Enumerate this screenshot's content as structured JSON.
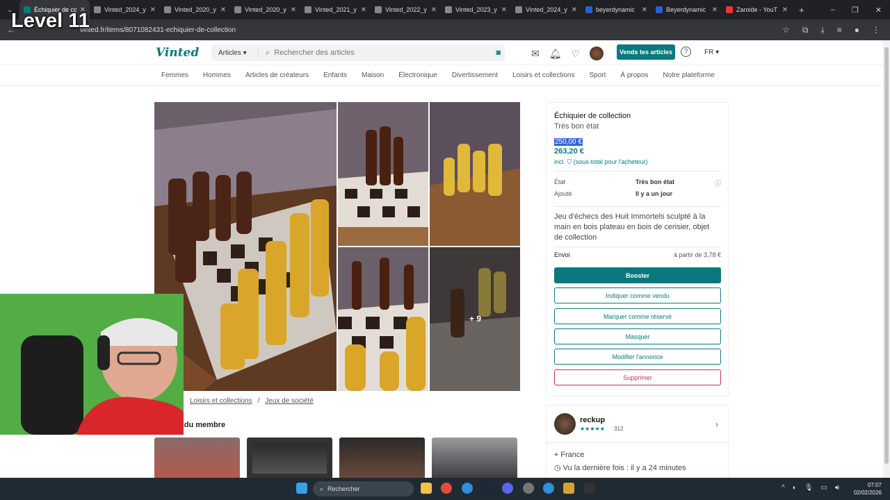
{
  "overlay": {
    "level_text": "Level 11"
  },
  "browser": {
    "tabs": [
      {
        "label": "Échiquier de co",
        "active": true,
        "fav": "#09797e"
      },
      {
        "label": "Vinted_2024_y",
        "active": false,
        "fav": "#888"
      },
      {
        "label": "Vinted_2020_y",
        "active": false,
        "fav": "#888"
      },
      {
        "label": "Vinted_2020_y",
        "active": false,
        "fav": "#888"
      },
      {
        "label": "Vinted_2021_y",
        "active": false,
        "fav": "#888"
      },
      {
        "label": "Vinted_2022_y",
        "active": false,
        "fav": "#888"
      },
      {
        "label": "Vinted_2023_y",
        "active": false,
        "fav": "#888"
      },
      {
        "label": "Vinted_2024_y",
        "active": false,
        "fav": "#888"
      },
      {
        "label": "beyerdynamic",
        "active": false,
        "fav": "#2a62c9"
      },
      {
        "label": "Beyerdynamic",
        "active": false,
        "fav": "#2a62c9"
      },
      {
        "label": "Zaroide - YouT",
        "active": false,
        "fav": "#e53935"
      }
    ],
    "url": "vinted.fr/items/8071082431-echiquier-de-collection"
  },
  "header": {
    "logo": "Vinted",
    "category_select": "Articles",
    "search_placeholder": "Rechercher des articles",
    "sell_button": "Vends tes articles",
    "help": "?",
    "lang": "FR"
  },
  "nav": [
    "Femmes",
    "Hommes",
    "Articles de créateurs",
    "Enfants",
    "Maison",
    "Électronique",
    "Divertissement",
    "Loisirs et collections",
    "Sport",
    "À propos",
    "Notre plateforme"
  ],
  "gallery": {
    "more_label": "+ 9"
  },
  "item": {
    "title": "Échiquier de collection",
    "condition": "Très bon état",
    "price": "250,00 €",
    "price_total": "263,20 €",
    "incl_label": "incl. ",
    "incl_note": "(sous-total pour l'acheteur)",
    "details": [
      {
        "label": "État",
        "value": "Très bon état"
      },
      {
        "label": "Ajouté",
        "value": "Il y a un jour"
      }
    ],
    "description": "Jeu d'échecs des Huit Immortels sculpté à la main en bois plateau en bois de cerisier, objet de collection",
    "shipping_label": "Envoi",
    "shipping_value": "à partir de 3,78 €",
    "buttons": {
      "boost": "Booster",
      "sold": "Indiquer comme vendu",
      "reserved": "Marquer comme réservé",
      "hide": "Masquer",
      "edit": "Modifier l'annonce",
      "delete": "Supprimer"
    }
  },
  "seller": {
    "name": "reckup",
    "stars": "★★★★★",
    "rating_count": "312",
    "location": "France",
    "last_seen": "Vu la dernière fois : il y a 24 minutes"
  },
  "breadcrumb": [
    "Loisirs et collections",
    "/",
    "Jeux de société"
  ],
  "member_section": "g du membre",
  "taskbar": {
    "search": "Rechercher",
    "time": "07:07",
    "date": "02/02/2026"
  },
  "colors": {
    "brand": "#09797e",
    "danger": "#c03050"
  }
}
